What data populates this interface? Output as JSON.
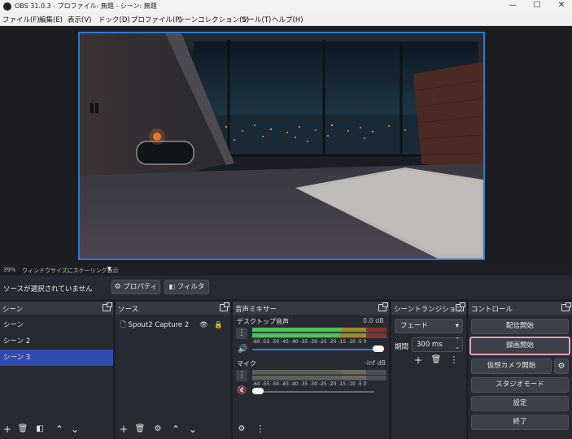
{
  "window": {
    "title": "OBS 31.0.3 - プロファイル: 無題 - シーン: 無題"
  },
  "menu": [
    "ファイル(F)",
    "編集(E)",
    "表示(V)",
    "ドック(D)",
    "プロファイル(P)",
    "シーンコレクション(S)",
    "ツール(T)",
    "ヘルプ(H)"
  ],
  "status": {
    "zoom": "39%",
    "scaling": "ウィンドウサイズにスケーリング表示",
    "dropdown": "▾"
  },
  "sourcebar": {
    "no_source": "ソースが選択されていません",
    "properties": "プロパティ",
    "filters": "フィルタ"
  },
  "scenes": {
    "title": "シーン",
    "items": [
      "シーン",
      "シーン 2",
      "シーン 3"
    ],
    "selected": 2
  },
  "sources": {
    "title": "ソース",
    "items": [
      "Spout2 Capture 2"
    ]
  },
  "mixer": {
    "title": "音声ミキサー",
    "channels": [
      {
        "name": "デスクトップ音声",
        "level": "0.0 dB"
      },
      {
        "name": "マイク",
        "level": "-inf dB"
      }
    ],
    "ticks": "-60 -55 -50 -45 -40 -35 -30 -25 -20 -15 -10  -5   0"
  },
  "transitions": {
    "title": "シーントランジション",
    "type": "フェード",
    "duration_label": "期間",
    "duration": "300 ms"
  },
  "controls": {
    "title": "コントロール",
    "buttons": [
      "配信開始",
      "録画開始",
      "仮想カメラ開始",
      "スタジオモード",
      "設定",
      "終了"
    ]
  },
  "colors": {
    "accent": "#2d7bd3",
    "selected": "#2f4bb0",
    "record_highlight": "#e8a0b0",
    "meter_green": "#49c35a",
    "meter_yellow": "#c9b43a",
    "meter_red": "#c63a3a"
  }
}
